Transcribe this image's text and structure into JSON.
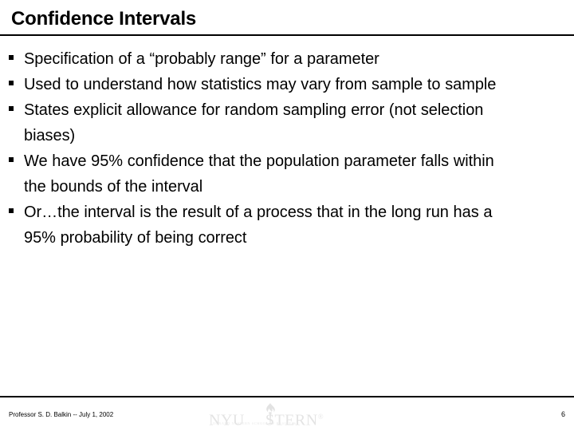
{
  "slide": {
    "title": "Confidence Intervals",
    "page_number": "6",
    "background_color": "#ffffff",
    "text_color": "#000000",
    "rule_color": "#000000"
  },
  "body": {
    "bullet_glyph": "square-bullet",
    "bullets": [
      {
        "text": "Specification of a “probably range” for a parameter"
      },
      {
        "text": "Used to understand how statistics may vary from sample to sample"
      },
      {
        "text": "States explicit allowance for random sampling error (not selection biases)"
      },
      {
        "text": "We have 95% confidence that the population parameter falls within the bounds of the interval"
      },
      {
        "text": "Or…the interval is the result of a process that in the long run has a 95% probability of being correct"
      }
    ]
  },
  "footer": {
    "credit": "Professor S. D. Balkin -- July 1, 2002",
    "page_number": "6",
    "logo": {
      "nyu": "NYU",
      "stern": "STERN",
      "trademark": "®",
      "tagline": "LEONARD N. STERN SCHOOL OF BUSINESS",
      "color": "#e4e4e4"
    }
  }
}
